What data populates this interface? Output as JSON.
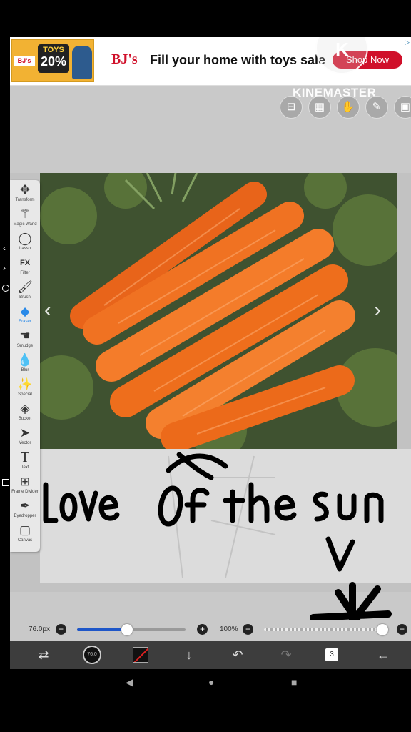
{
  "ad": {
    "image_tag_line1": "TOYS",
    "image_tag_line2": "20%",
    "image_store": "BJ's",
    "logo": "BJ's",
    "headline": "Fill your home with toys sale",
    "cta": "Shop Now"
  },
  "watermark": {
    "brand": "KINEMASTER"
  },
  "toolbar": {
    "tools": [
      {
        "label": "Transform",
        "icon": "move-icon"
      },
      {
        "label": "Magic Wand",
        "icon": "magic-wand-icon"
      },
      {
        "label": "Lasso",
        "icon": "lasso-icon"
      },
      {
        "label": "Filter",
        "icon": "fx-icon",
        "glyph": "FX"
      },
      {
        "label": "Brush",
        "icon": "brush-icon"
      },
      {
        "label": "Eraser",
        "icon": "eraser-icon",
        "active": true
      },
      {
        "label": "Smudge",
        "icon": "smudge-icon"
      },
      {
        "label": "Blur",
        "icon": "blur-drop-icon"
      },
      {
        "label": "Special",
        "icon": "special-brush-icon"
      },
      {
        "label": "Bucket",
        "icon": "bucket-icon"
      },
      {
        "label": "Vector",
        "icon": "vector-cursor-icon"
      },
      {
        "label": "Text",
        "icon": "text-icon",
        "glyph": "T"
      },
      {
        "label": "Frame Divider",
        "icon": "frame-divider-icon"
      },
      {
        "label": "Eyedropper",
        "icon": "eyedropper-icon"
      },
      {
        "label": "Canvas",
        "icon": "canvas-icon"
      }
    ],
    "active_color": "#2a8ae8"
  },
  "canvas": {
    "handwriting": "Love of the sun",
    "ink_color": "#000000"
  },
  "controls": {
    "brush_size": "76.0px",
    "brush_size_fraction": 0.46,
    "opacity": "100%",
    "opacity_fraction": 1.0,
    "layer_count": "3",
    "brush_preview_label": "76.0"
  }
}
